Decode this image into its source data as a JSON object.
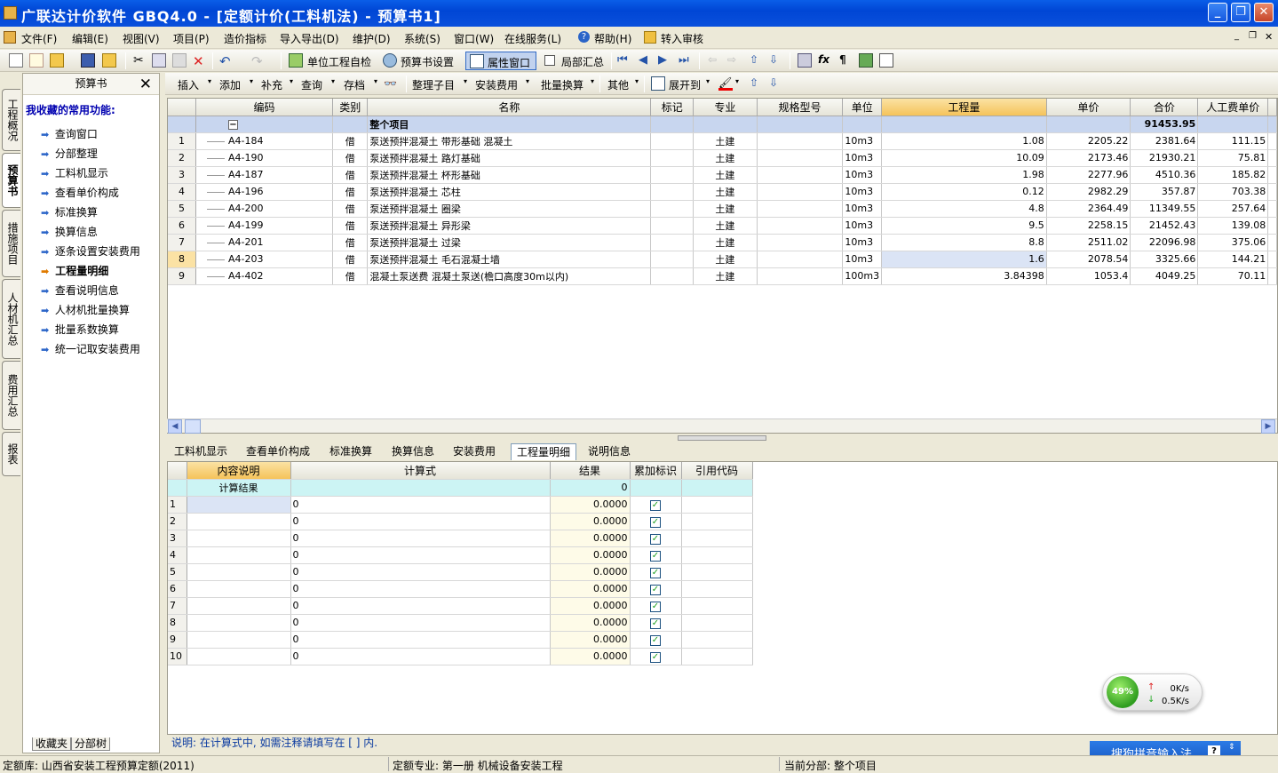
{
  "app": {
    "title": "广联达计价软件  GBQ4.0 - [定额计价(工料机法) - 预算书1]"
  },
  "menu": [
    "文件(F)",
    "编辑(E)",
    "视图(V)",
    "项目(P)",
    "造价指标",
    "导入导出(D)",
    "维护(D)",
    "系统(S)",
    "窗口(W)",
    "在线服务(L)",
    "帮助(H)",
    "转入审核"
  ],
  "toolbar1": {
    "check": "单位工程自检",
    "settings": "预算书设置",
    "property": "属性窗口",
    "partial": "局部汇总"
  },
  "toolbar2": {
    "insert": "插入",
    "add": "添加",
    "supplement": "补充",
    "query": "查询",
    "archive": "存档",
    "organize": "整理子目",
    "install_fee": "安装费用",
    "batch": "批量换算",
    "other": "其他",
    "expand": "展开到"
  },
  "side_tabs": [
    "工程概况",
    "预算书",
    "措施项目",
    "人材机汇总",
    "费用汇总",
    "报表"
  ],
  "left_panel": {
    "title": "预算书",
    "fav_title": "我收藏的常用功能:",
    "items": [
      "查询窗口",
      "分部整理",
      "工料机显示",
      "查看单价构成",
      "标准换算",
      "换算信息",
      "逐条设置安装费用",
      "工程量明细",
      "查看说明信息",
      "人材机批量换算",
      "批量系数换算",
      "统一记取安装费用"
    ],
    "tabs": [
      "收藏夹",
      "分部树"
    ]
  },
  "grid": {
    "headers": [
      "编码",
      "类别",
      "名称",
      "标记",
      "专业",
      "规格型号",
      "单位",
      "工程量",
      "单价",
      "合价",
      "人工费单价"
    ],
    "total_label": "整个项目",
    "total": "91453.95",
    "rows": [
      [
        "1",
        "A4-184",
        "借",
        "泵送预拌混凝土 带形基础 混凝土",
        "",
        "土建",
        "",
        "10m3",
        "1.08",
        "2205.22",
        "2381.64",
        "111.15"
      ],
      [
        "2",
        "A4-190",
        "借",
        "泵送预拌混凝土 路灯基础",
        "",
        "土建",
        "",
        "10m3",
        "10.09",
        "2173.46",
        "21930.21",
        "75.81"
      ],
      [
        "3",
        "A4-187",
        "借",
        "泵送预拌混凝土 杯形基础",
        "",
        "土建",
        "",
        "10m3",
        "1.98",
        "2277.96",
        "4510.36",
        "185.82"
      ],
      [
        "4",
        "A4-196",
        "借",
        "泵送预拌混凝土 芯柱",
        "",
        "土建",
        "",
        "10m3",
        "0.12",
        "2982.29",
        "357.87",
        "703.38"
      ],
      [
        "5",
        "A4-200",
        "借",
        "泵送预拌混凝土 圈梁",
        "",
        "土建",
        "",
        "10m3",
        "4.8",
        "2364.49",
        "11349.55",
        "257.64"
      ],
      [
        "6",
        "A4-199",
        "借",
        "泵送预拌混凝土 异形梁",
        "",
        "土建",
        "",
        "10m3",
        "9.5",
        "2258.15",
        "21452.43",
        "139.08"
      ],
      [
        "7",
        "A4-201",
        "借",
        "泵送预拌混凝土 过梁",
        "",
        "土建",
        "",
        "10m3",
        "8.8",
        "2511.02",
        "22096.98",
        "375.06"
      ],
      [
        "8",
        "A4-203",
        "借",
        "泵送预拌混凝土 毛石混凝土墙",
        "",
        "土建",
        "",
        "10m3",
        "1.6",
        "2078.54",
        "3325.66",
        "144.21"
      ],
      [
        "9",
        "A4-402",
        "借",
        "混凝土泵送费 混凝土泵送(檐口高度30m以内)",
        "",
        "土建",
        "",
        "100m3",
        "3.84398",
        "1053.4",
        "4049.25",
        "70.11"
      ]
    ]
  },
  "bottom_tabs": [
    "工料机显示",
    "查看单价构成",
    "标准换算",
    "换算信息",
    "安装费用",
    "工程量明细",
    "说明信息"
  ],
  "detail": {
    "headers": [
      "内容说明",
      "计算式",
      "结果",
      "累加标识",
      "引用代码"
    ],
    "result_label": "计算结果",
    "result_value": "0",
    "rows": [
      [
        "1",
        "",
        "0",
        "0.0000"
      ],
      [
        "2",
        "",
        "0",
        "0.0000"
      ],
      [
        "3",
        "",
        "0",
        "0.0000"
      ],
      [
        "4",
        "",
        "0",
        "0.0000"
      ],
      [
        "5",
        "",
        "0",
        "0.0000"
      ],
      [
        "6",
        "",
        "0",
        "0.0000"
      ],
      [
        "7",
        "",
        "0",
        "0.0000"
      ],
      [
        "8",
        "",
        "0",
        "0.0000"
      ],
      [
        "9",
        "",
        "0",
        "0.0000"
      ],
      [
        "10",
        "",
        "0",
        "0.0000"
      ]
    ]
  },
  "note": "说明: 在计算式中, 如需注释请填写在 [ ] 内.",
  "status": {
    "quota_lib": "定额库: 山西省安装工程预算定额(2011)",
    "quota_major": "定额专业: 第一册 机械设备安装工程",
    "current": "当前分部: 整个项目"
  },
  "net": {
    "percent": "49%",
    "up": "0K/s",
    "down": "0.5K/s"
  },
  "ime": {
    "label": "搜狗拼音输入法"
  }
}
